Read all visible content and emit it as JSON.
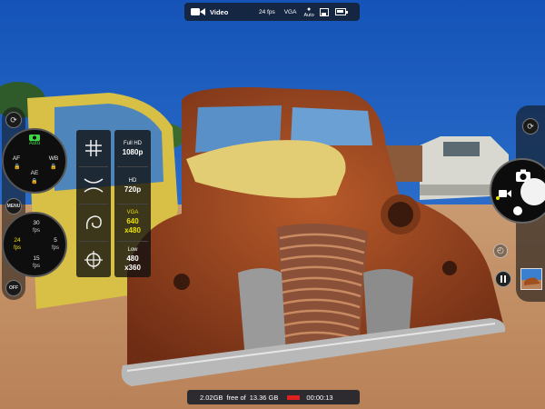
{
  "top_bar": {
    "mode": "Video",
    "fps": "24 fps",
    "resolution": "VGA",
    "wb_label": "Auto"
  },
  "bottom_bar": {
    "free_space": "2.02GB",
    "free_of": "free of",
    "total_space": "13.36 GB",
    "elapsed": "00:00:13"
  },
  "left_panel": {
    "exposure_dial": {
      "top": "Auto",
      "left": "AF",
      "right": "WB",
      "bottom": "AE"
    },
    "menu_label": "MENU",
    "off_label": "OFF",
    "fps_dial": {
      "top": "30\nfps",
      "left": "24\nfps",
      "right": "5\nfps",
      "bottom": "15\nfps"
    },
    "fps_top": "30",
    "fps_left": "24",
    "fps_right": "5",
    "fps_bottom": "15",
    "fps_unit": "fps",
    "resolutions": [
      {
        "name": "Full HD",
        "value": "1080p",
        "selected": false
      },
      {
        "name": "HD",
        "value": "720p",
        "selected": false
      },
      {
        "name": "VGA",
        "value": "640\nx480",
        "selected": true
      },
      {
        "name": "Low",
        "value": "480\nx360",
        "selected": false
      }
    ],
    "res_0_name": "Full HD",
    "res_0_value": "1080p",
    "res_1_name": "HD",
    "res_1_value": "720p",
    "res_2_name": "VGA",
    "res_2_value_a": "640",
    "res_2_value_b": "x480",
    "res_3_name": "Low",
    "res_3_value_a": "480",
    "res_3_value_b": "x360",
    "grid_icons": [
      "grid-icon",
      "cross-lines-icon",
      "spiral-icon",
      "crosshair-icon"
    ]
  },
  "colors": {
    "accent_selected": "#e8e000",
    "record_red": "#e02020",
    "auto_green": "#3fd64a"
  }
}
